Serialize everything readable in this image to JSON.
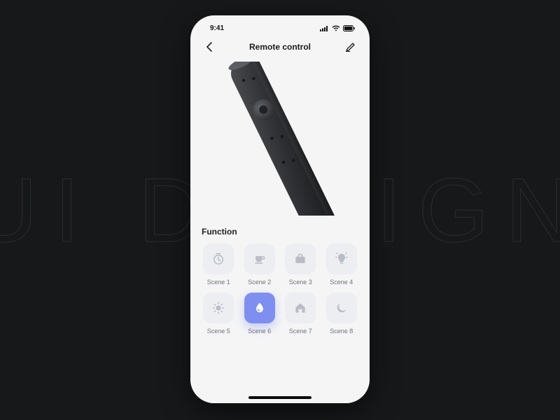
{
  "bg_text": "UI DESIGN",
  "status": {
    "time": "9:41"
  },
  "nav": {
    "title": "Remote control"
  },
  "functions": {
    "title": "Function",
    "scenes": [
      {
        "label": "Scene 1",
        "icon": "timer-icon"
      },
      {
        "label": "Scene 2",
        "icon": "cup-icon"
      },
      {
        "label": "Scene 3",
        "icon": "briefcase-icon"
      },
      {
        "label": "Scene 4",
        "icon": "bulb-icon"
      },
      {
        "label": "Scene 5",
        "icon": "sun-icon"
      },
      {
        "label": "Scene 6",
        "icon": "drop-icon",
        "active": true
      },
      {
        "label": "Scene 7",
        "icon": "home-icon"
      },
      {
        "label": "Scene 8",
        "icon": "moon-icon"
      }
    ]
  }
}
